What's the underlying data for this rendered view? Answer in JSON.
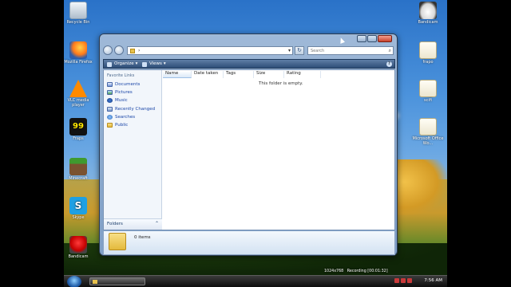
{
  "desktop": {
    "left_icons": [
      {
        "label": "Recycle Bin",
        "icon": "recycle-bin-icon"
      },
      {
        "label": "Mozilla Firefox",
        "icon": "firefox-icon"
      },
      {
        "label": "VLC media player",
        "icon": "vlc-icon"
      },
      {
        "label": "Fraps",
        "icon": "fraps-icon"
      },
      {
        "label": "Minecraft",
        "icon": "minecraft-icon"
      },
      {
        "label": "Skype",
        "icon": "skype-icon"
      },
      {
        "label": "Bandicam",
        "icon": "bandicam-icon"
      }
    ],
    "right_icons": [
      {
        "label": "Bandicam",
        "icon": "hat-icon"
      },
      {
        "label": "frapo",
        "icon": "text-file-icon"
      },
      {
        "label": "scifi",
        "icon": "text-file-icon"
      },
      {
        "label": "Microsoft Office Wo...",
        "icon": "office-doc-icon"
      }
    ],
    "recording_text": "Recording [00:01:32]",
    "resolution_text": "1024x768"
  },
  "window": {
    "search_placeholder": "Search",
    "toolbar": {
      "organize": "Organize",
      "views": "Views"
    },
    "favorite_links_title": "Favorite Links",
    "favorites": [
      "Documents",
      "Pictures",
      "Music",
      "Recently Changed",
      "Searches",
      "Public"
    ],
    "folders_label": "Folders",
    "columns": [
      "Name",
      "Date taken",
      "Tags",
      "Size",
      "Rating"
    ],
    "empty_text": "This folder is empty.",
    "details_count": "0 items"
  },
  "taskbar": {
    "clock": "7:56 AM"
  },
  "colors": {
    "accent": "#2e4e78",
    "link": "#1a46a8"
  }
}
